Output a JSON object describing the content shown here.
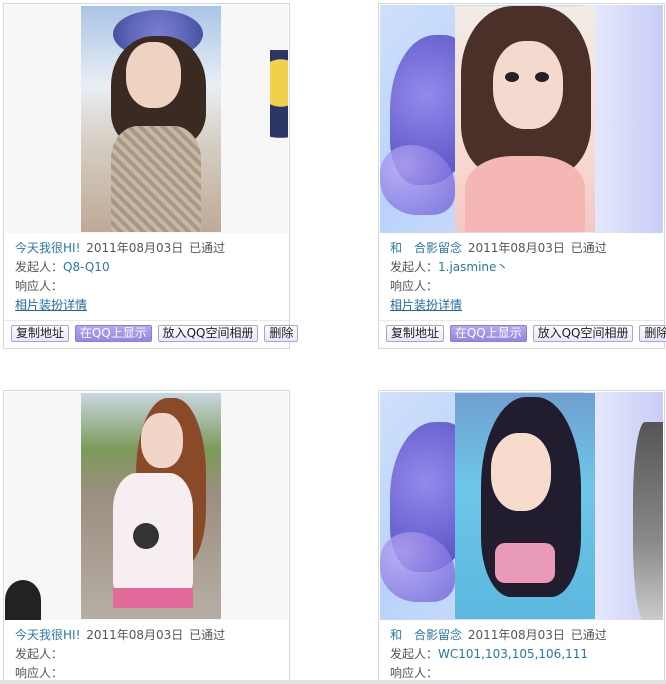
{
  "cards": [
    {
      "mood": "今天我很HI!",
      "date": "2011年08月03日",
      "status": "已通过",
      "initiator_label": "发起人：",
      "initiator": "Q8-Q10",
      "responder_label": "响应人：",
      "responder": "",
      "detail_link": "相片装扮详情",
      "buttons": [
        "复制地址",
        "在QQ上显示",
        "放入QQ空间相册",
        "删除"
      ]
    },
    {
      "mood": "和　合影留念",
      "date": "2011年08月03日",
      "status": "已通过",
      "initiator_label": "发起人：",
      "initiator": "1.jasmine丶",
      "responder_label": "响应人：",
      "responder": "",
      "detail_link": "相片装扮详情",
      "buttons": [
        "复制地址",
        "在QQ上显示",
        "放入QQ空间相册",
        "删除"
      ]
    },
    {
      "mood": "今天我很HI!",
      "date": "2011年08月03日",
      "status": "已通过",
      "initiator_label": "发起人：",
      "initiator": "",
      "responder_label": "响应人：",
      "responder": ""
    },
    {
      "mood": "和　合影留念",
      "date": "2011年08月03日",
      "status": "已通过",
      "initiator_label": "发起人：",
      "initiator": "WC101,103,105,106,111",
      "responder_label": "响应人：",
      "responder": ""
    }
  ],
  "colors": {
    "link": "#2a77a8",
    "button_border": "#a9a1e1",
    "primary_button": "#9387e0"
  }
}
